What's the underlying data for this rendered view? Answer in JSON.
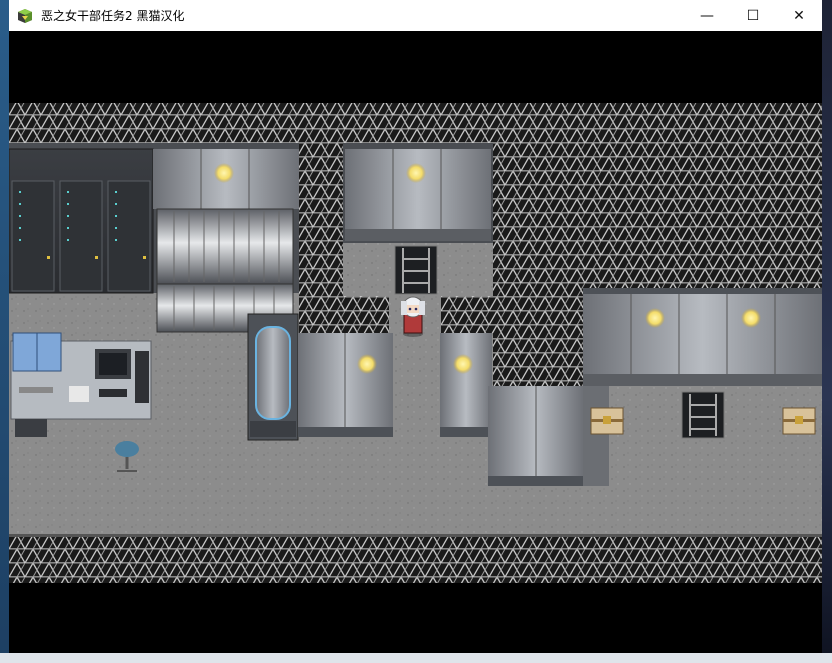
{
  "window": {
    "title": "恶之女干部任务2 黑猫汉化",
    "app_icon": "rpg-maker-icon",
    "controls": {
      "minimize": "—",
      "maximize": "☐",
      "close": "✕"
    }
  },
  "colors": {
    "floor": "#8a8a8a",
    "mesh": "#2b2b2b",
    "wall_panel": "#9a9ea4",
    "lamp": "#f5e27a",
    "server_led": "#5ad0d0"
  },
  "game": {
    "player": {
      "sprite": "white-haired-girl-red-outfit",
      "facing": "down"
    }
  }
}
